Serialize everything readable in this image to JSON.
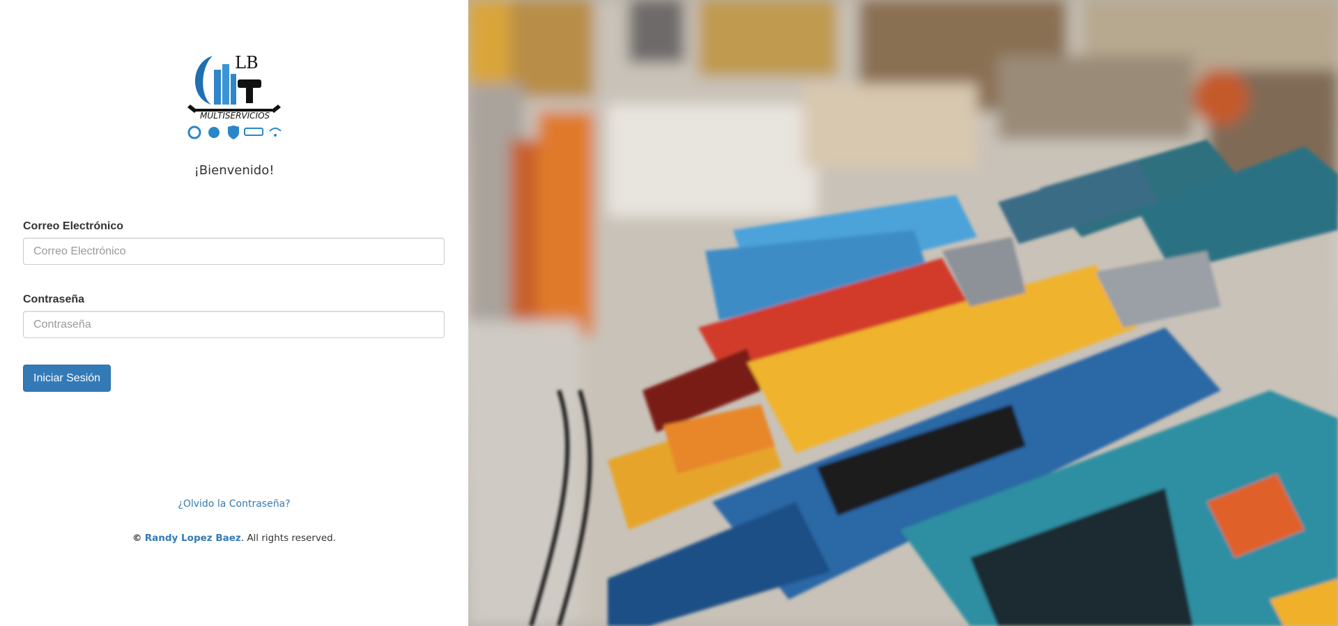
{
  "brand": {
    "logo_text": "LB",
    "logo_subtext": "MULTISERVICIOS"
  },
  "welcome": "¡Bienvenido!",
  "form": {
    "email_label": "Correo Electrónico",
    "email_placeholder": "Correo Electrónico",
    "email_value": "",
    "password_label": "Contraseña",
    "password_placeholder": "Contraseña",
    "password_value": "",
    "submit_label": "Iniciar Sesión"
  },
  "links": {
    "forgot_password": "¿Olvido la Contraseña?"
  },
  "footer": {
    "copyright_symbol": "©",
    "author": "Randy Lopez Baez",
    "suffix": ". All rights reserved."
  },
  "colors": {
    "primary": "#337ab7",
    "text": "#333333",
    "border": "#cccccc"
  },
  "icons": [
    "wrench-icon",
    "touch-icon",
    "refresh-icon",
    "shield-lock-icon",
    "security-camera-icon",
    "wifi-icon"
  ]
}
